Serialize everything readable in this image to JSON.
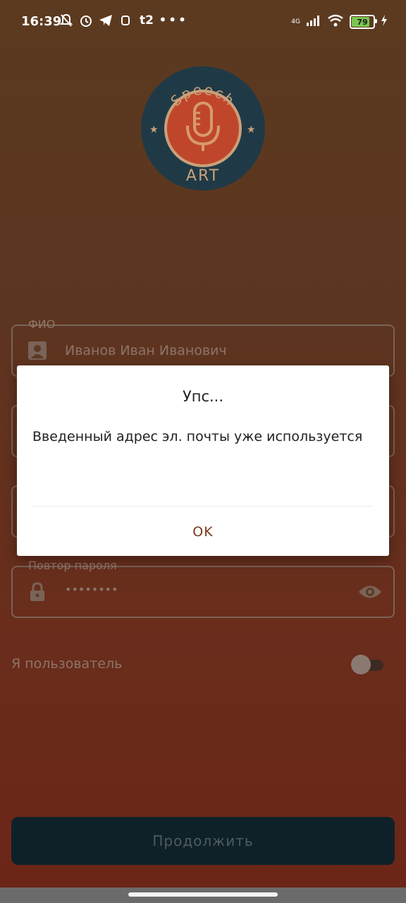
{
  "status_bar": {
    "time": "16:39",
    "network": "4G",
    "battery_percent": "79",
    "dots": "•••",
    "icons": [
      "mute-bell-icon",
      "alarm-icon",
      "telegram-icon",
      "app-icon",
      "t2-icon"
    ]
  },
  "logo": {
    "top_text": "Speech",
    "bottom_text": "ART"
  },
  "form": {
    "fio": {
      "label": "ФИО",
      "value": "Иванов Иван Иванович"
    },
    "repeat_password": {
      "label": "Повтор пароля",
      "value": "••••••••"
    },
    "user_toggle": {
      "label": "Я пользователь",
      "on": false
    },
    "continue_label": "Продолжить"
  },
  "dialog": {
    "title": "Упс...",
    "message": "Введенный адрес эл. почты уже используется",
    "ok_label": "OK"
  },
  "colors": {
    "accent": "#7a3a1c",
    "button_bg": "#0f2128",
    "logo_bg": "#1f3a46",
    "logo_inner": "#c0462b"
  }
}
